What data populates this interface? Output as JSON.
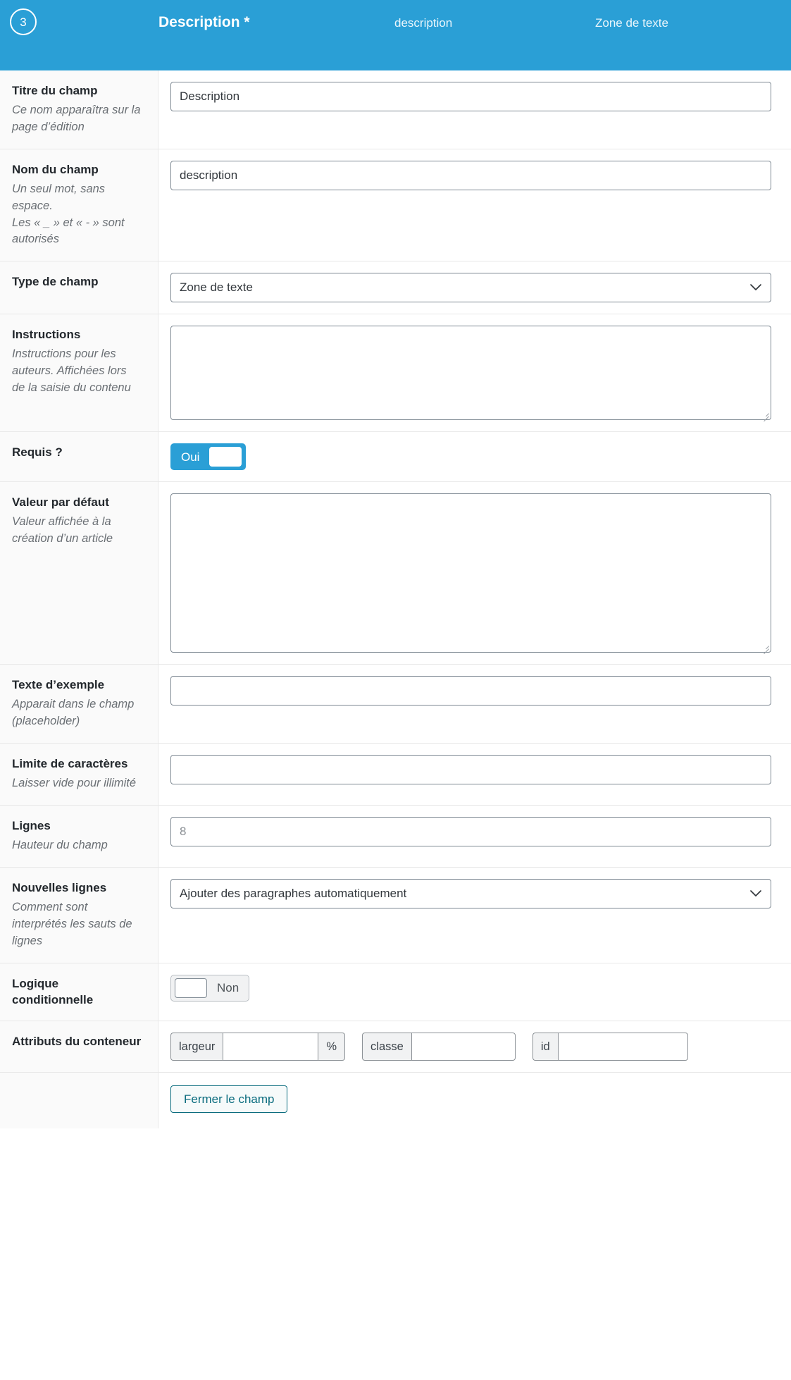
{
  "header": {
    "order_number": "3",
    "title": "Description *",
    "field_name": "description",
    "field_type": "Zone de texte",
    "background_color": "#2a9fd6"
  },
  "rows": {
    "title": {
      "label": "Titre du champ",
      "hint": "Ce nom apparaîtra sur la page d’édition",
      "value": "Description"
    },
    "name": {
      "label": "Nom du champ",
      "hint": "Un seul mot, sans espace.\nLes « _ » et « - » sont autorisés",
      "value": "description"
    },
    "type": {
      "label": "Type de champ",
      "hint": "",
      "value": "Zone de texte",
      "options": [
        "Zone de texte"
      ]
    },
    "instructions": {
      "label": "Instructions",
      "hint": "Instructions pour les auteurs. Affichées lors de la saisie du contenu",
      "value": ""
    },
    "required": {
      "label": "Requis ?",
      "hint": "",
      "toggle_label": "Oui",
      "toggle_state": "on"
    },
    "default_value": {
      "label": "Valeur par défaut",
      "hint": "Valeur affichée à la création d’un article",
      "value": ""
    },
    "placeholder": {
      "label": "Texte d’exemple",
      "hint": "Apparait dans le champ (placeholder)",
      "value": ""
    },
    "maxlength": {
      "label": "Limite de caractères",
      "hint": "Laisser vide pour illimité",
      "value": ""
    },
    "rows": {
      "label": "Lignes",
      "hint": "Hauteur du champ",
      "value": "",
      "placeholder": "8"
    },
    "new_lines": {
      "label": "Nouvelles lignes",
      "hint": "Comment sont interprétés les sauts de lignes",
      "value": "Ajouter des paragraphes automatiquement",
      "options": [
        "Ajouter des paragraphes automatiquement"
      ]
    },
    "conditional_logic": {
      "label": "Logique conditionnelle",
      "hint": "",
      "toggle_label": "Non",
      "toggle_state": "off"
    },
    "wrapper_attributes": {
      "label": "Attributs du conteneur",
      "hint": "",
      "width_addon": "largeur",
      "width_value": "",
      "width_unit": "%",
      "class_addon": "classe",
      "class_value": "",
      "id_addon": "id",
      "id_value": ""
    }
  },
  "footer": {
    "close_field_label": "Fermer le champ"
  }
}
